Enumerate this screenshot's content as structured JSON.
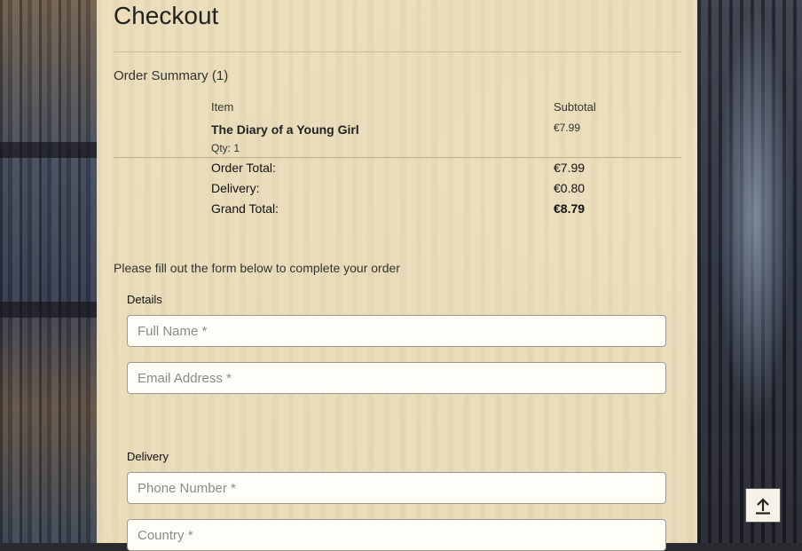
{
  "page": {
    "title": "Checkout"
  },
  "order_summary": {
    "heading": "Order Summary (1)",
    "columns": {
      "item": "Item",
      "subtotal": "Subtotal"
    },
    "items": [
      {
        "name": "The Diary of a Young Girl",
        "qty": "Qty: 1",
        "subtotal": "€7.99"
      }
    ],
    "totals": {
      "order_total_label": "Order Total:",
      "order_total_value": "€7.99",
      "delivery_label": "Delivery:",
      "delivery_value": "€0.80",
      "grand_total_label": "Grand Total:",
      "grand_total_value": "€8.79"
    }
  },
  "form": {
    "intro": "Please fill out the form below to complete your order",
    "details_label": "Details",
    "full_name_placeholder": "Full Name *",
    "email_placeholder": "Email Address *",
    "delivery_label": "Delivery",
    "phone_placeholder": "Phone Number *",
    "country_placeholder": "Country *"
  },
  "controls": {
    "scroll_top_icon": "arrow-up-to-line-icon"
  }
}
